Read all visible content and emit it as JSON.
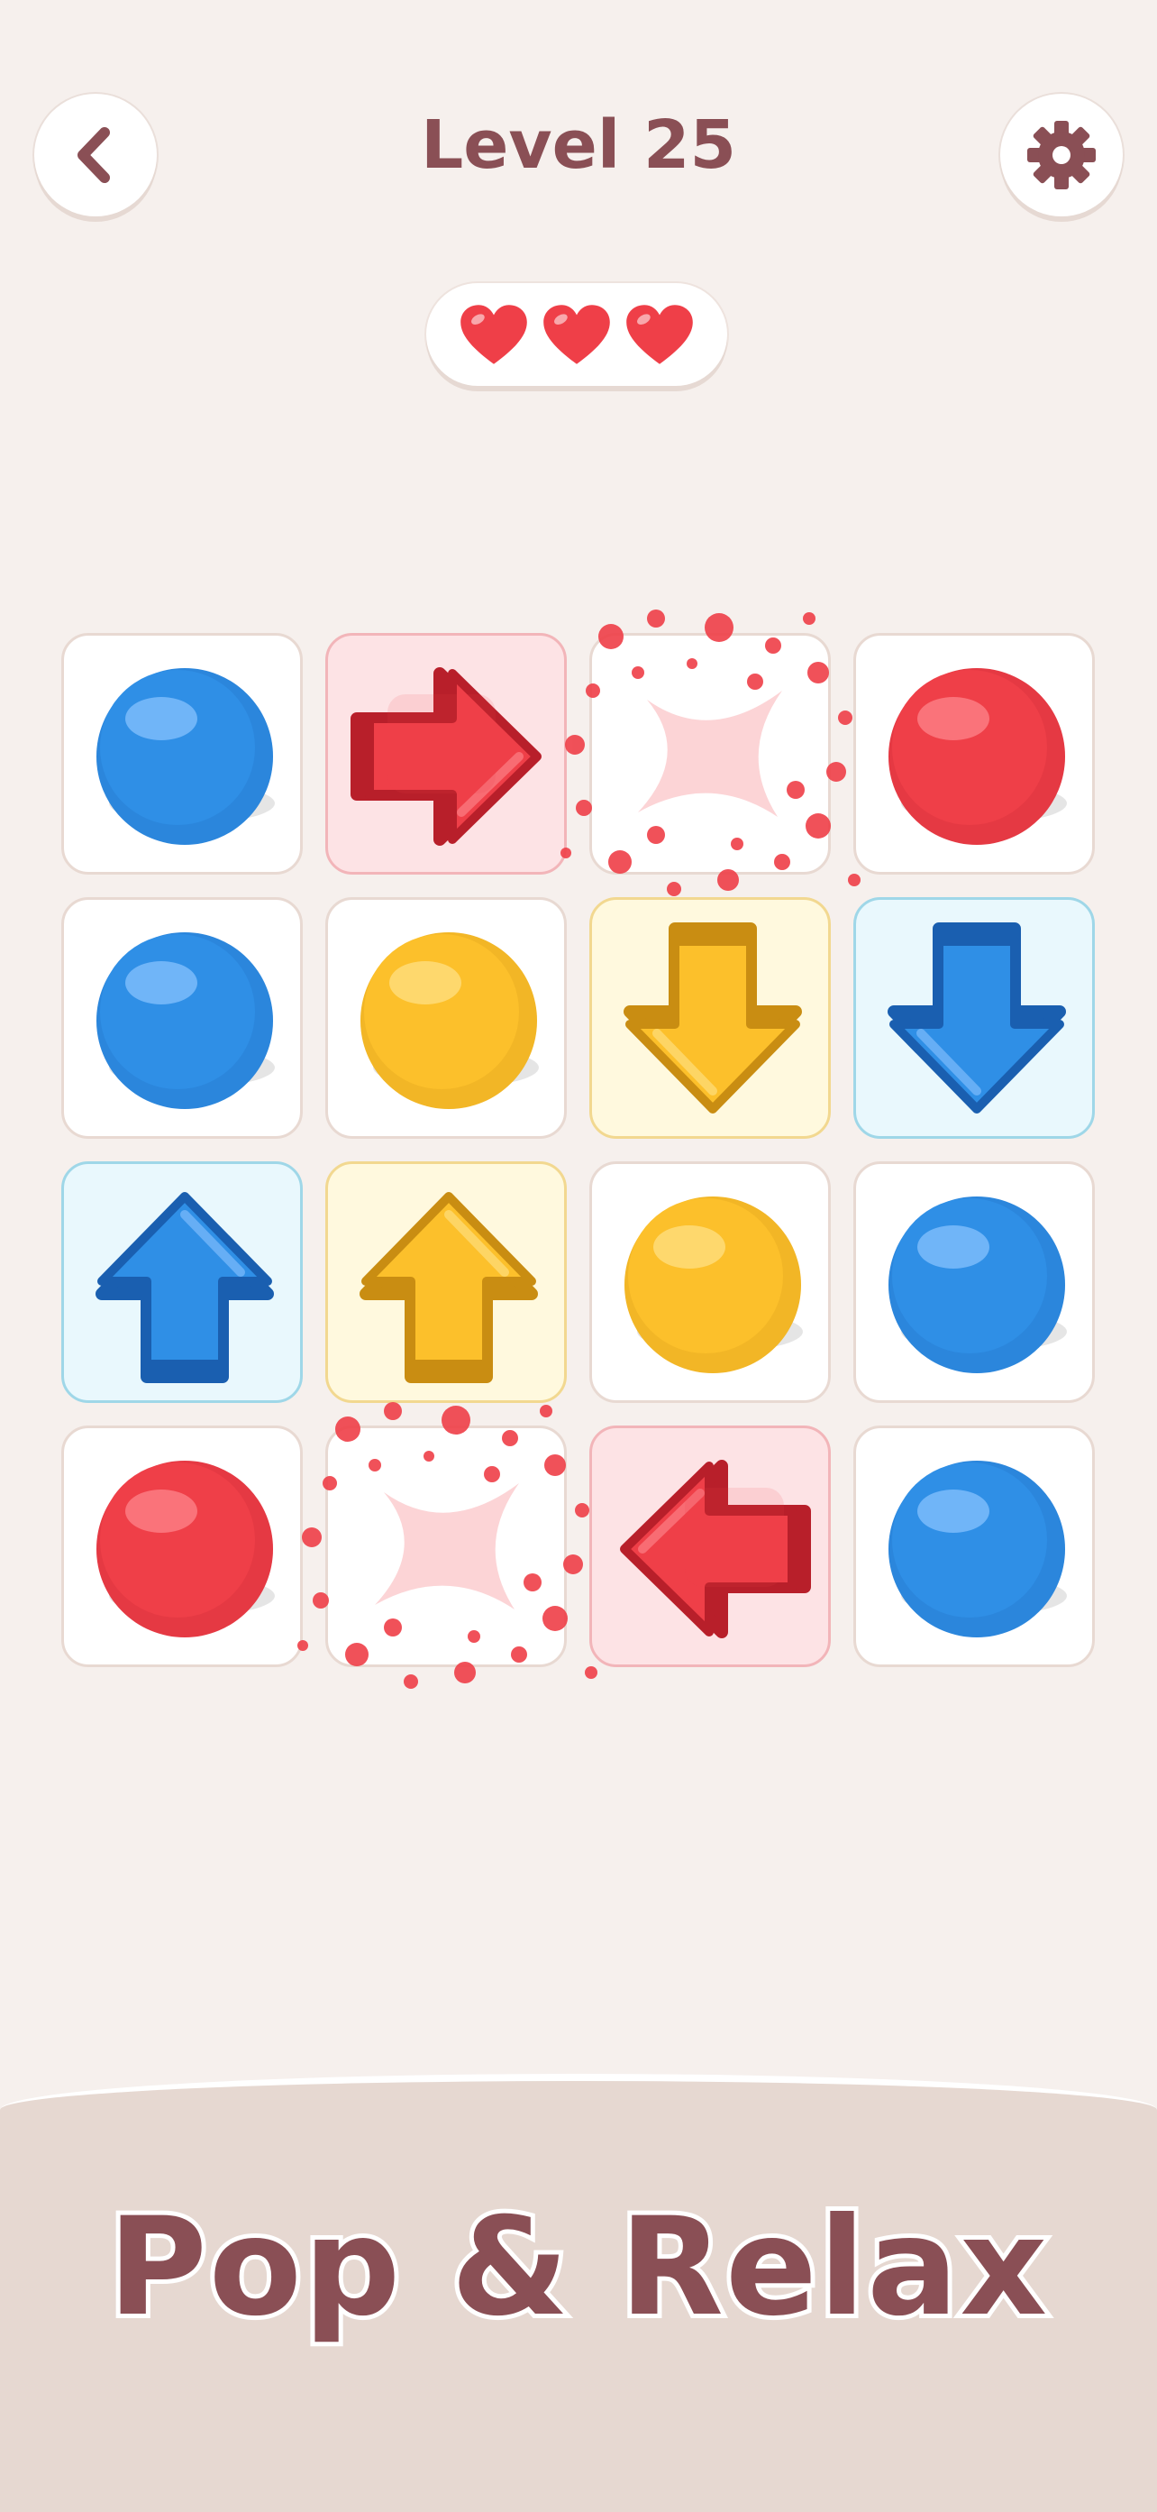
{
  "header": {
    "title": "Level 25",
    "back_icon": "chevron-left-icon",
    "settings_icon": "gear-icon"
  },
  "lives": {
    "count": 3,
    "max": 3,
    "icon": "heart-icon"
  },
  "board": {
    "rows": 4,
    "cols": 4,
    "cells": [
      [
        "ball-blue",
        "arrow-right-red",
        "empty",
        "ball-red"
      ],
      [
        "ball-blue",
        "ball-yellow",
        "arrow-down-yellow",
        "arrow-down-blue"
      ],
      [
        "arrow-up-blue",
        "arrow-up-yellow",
        "ball-yellow",
        "ball-blue"
      ],
      [
        "ball-red",
        "empty",
        "arrow-left-red",
        "ball-blue"
      ]
    ]
  },
  "colors": {
    "red": "#ef3f48",
    "blue": "#2f8fe6",
    "yellow": "#fcc02b",
    "title": "#8a4f55",
    "background": "#f6f0ed",
    "footer": "#e6d8d1"
  },
  "footer": {
    "slogan": "Pop & Relax"
  }
}
